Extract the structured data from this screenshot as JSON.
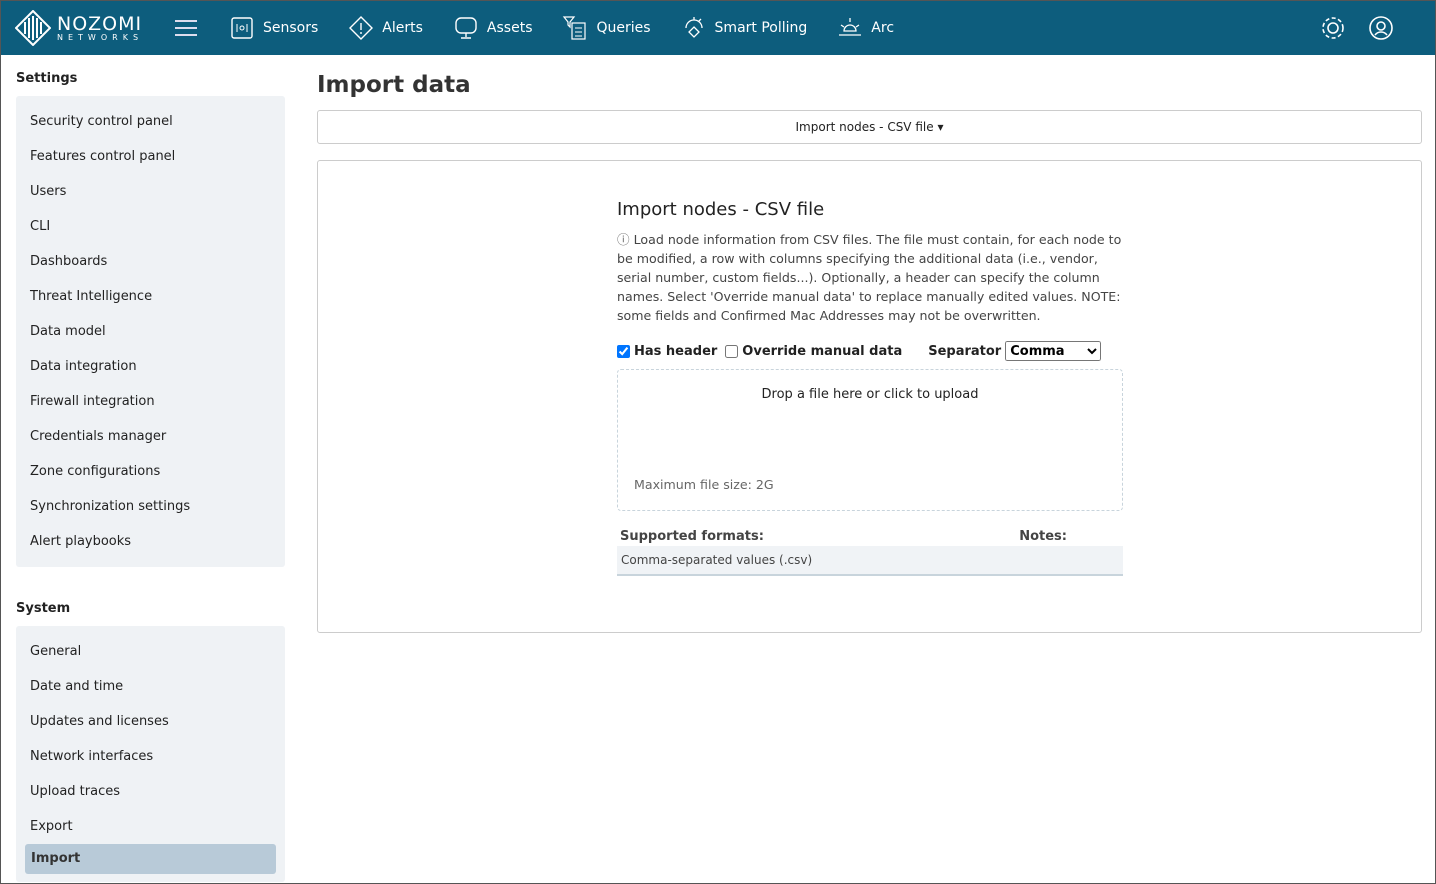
{
  "brand": {
    "name": "NOZOMI",
    "sub": "NETWORKS"
  },
  "nav": [
    {
      "label": "Sensors",
      "icon": "sensors-icon"
    },
    {
      "label": "Alerts",
      "icon": "alert-icon"
    },
    {
      "label": "Assets",
      "icon": "monitor-icon"
    },
    {
      "label": "Queries",
      "icon": "queries-icon"
    },
    {
      "label": "Smart Polling",
      "icon": "smart-polling-icon"
    },
    {
      "label": "Arc",
      "icon": "arc-icon"
    }
  ],
  "sidebar": {
    "settings_title": "Settings",
    "settings": [
      "Security control panel",
      "Features control panel",
      "Users",
      "CLI",
      "Dashboards",
      "Threat Intelligence",
      "Data model",
      "Data integration",
      "Firewall integration",
      "Credentials manager",
      "Zone configurations",
      "Synchronization settings",
      "Alert playbooks"
    ],
    "system_title": "System",
    "system": [
      "General",
      "Date and time",
      "Updates and licenses",
      "Network interfaces",
      "Upload traces",
      "Export",
      "Import"
    ],
    "active": "Import"
  },
  "main": {
    "title": "Import data",
    "dropdown": "Import nodes - CSV file",
    "card": {
      "title": "Import nodes - CSV file",
      "description": "Load node information from CSV files. The file must contain, for each node to be modified, a row with columns specifying the additional data (i.e., vendor, serial number, custom fields...). Optionally, a header can specify the column names. Select 'Override manual data' to replace manually edited values. NOTE: some fields and Confirmed Mac Addresses may not be overwritten.",
      "has_header": "Has header",
      "has_header_checked": true,
      "override": "Override manual data",
      "override_checked": false,
      "separator_label": "Separator",
      "separator": "Comma",
      "drop_text": "Drop a file here or click to upload",
      "max_size": "Maximum file size: 2G",
      "formats_header": "Supported formats:",
      "notes_header": "Notes:",
      "formats": [
        "Comma-separated values (.csv)"
      ]
    }
  },
  "colors": {
    "header": "#0d5d7d",
    "sidebar": "#eff2f5",
    "active": "#b8cad8"
  }
}
